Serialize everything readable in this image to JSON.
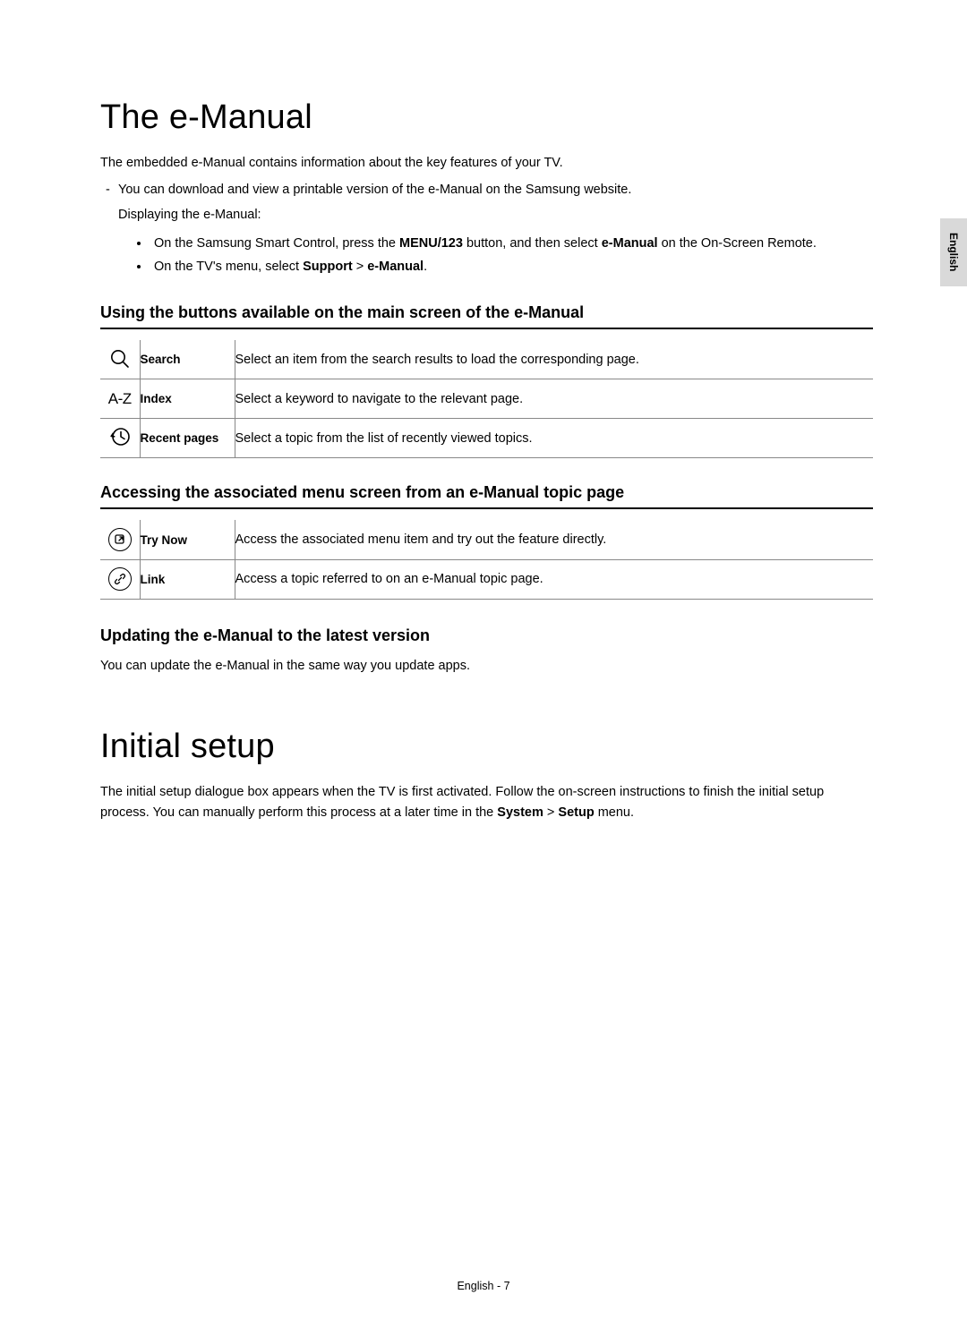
{
  "sideTab": "English",
  "section1": {
    "title": "The e-Manual",
    "intro": "The embedded e-Manual contains information about the key features of your TV.",
    "dash": "You can download and view a printable version of the e-Manual on the Samsung website.",
    "subline": "Displaying the e-Manual:",
    "bullets": [
      {
        "pre": "On the Samsung Smart Control, press the ",
        "b1": "MENU/123",
        "mid": " button, and then select ",
        "b2": "e-Manual",
        "post": " on the On-Screen Remote."
      },
      {
        "pre": "On the TV's menu, select ",
        "b1": "Support",
        "mid": " > ",
        "b2": "e-Manual",
        "post": "."
      }
    ],
    "sub1": {
      "heading": "Using the buttons available on the main screen of the e-Manual",
      "rows": [
        {
          "icon": "search-icon",
          "label": "Search",
          "desc": "Select an item from the search results to load the corresponding page."
        },
        {
          "icon": "az-icon",
          "label": "Index",
          "desc": "Select a keyword to navigate to the relevant page."
        },
        {
          "icon": "history-icon",
          "label": "Recent pages",
          "desc": "Select a topic from the list of recently viewed topics."
        }
      ]
    },
    "sub2": {
      "heading": "Accessing the associated menu screen from an e-Manual topic page",
      "rows": [
        {
          "icon": "trynow-icon",
          "label": "Try Now",
          "desc": "Access the associated menu item and try out the feature directly."
        },
        {
          "icon": "link-icon",
          "label": "Link",
          "desc": "Access a topic referred to on an e-Manual topic page."
        }
      ]
    },
    "sub3": {
      "heading": "Updating the e-Manual to the latest version",
      "text": "You can update the e-Manual in the same way you update apps."
    }
  },
  "section2": {
    "title": "Initial setup",
    "p_pre": "The initial setup dialogue box appears when the TV is first activated. Follow the on-screen instructions to finish the initial setup process. You can manually perform this process at a later time in the ",
    "b1": "System",
    "mid": " > ",
    "b2": "Setup",
    "post": " menu."
  },
  "footer": {
    "lang": "English",
    "sep": " - ",
    "page": "7"
  },
  "icons": {
    "az": "A-Z"
  }
}
